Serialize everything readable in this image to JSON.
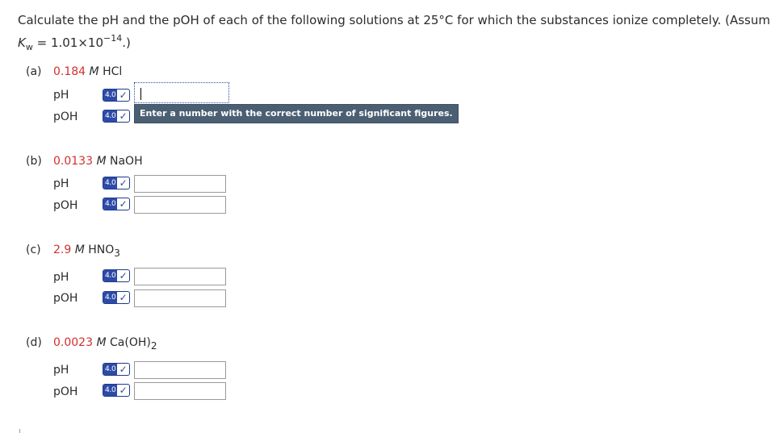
{
  "question": {
    "text": "Calculate the pH and the pOH of each of the following solutions at 25°C for which the substances ionize completely. (Assume",
    "kw_symbol": "K",
    "kw_sub": "w",
    "kw_value": " = 1.01×10",
    "kw_exp": "−14",
    "kw_end": ".)"
  },
  "parts": [
    {
      "letter": "(a)",
      "conc": "0.184",
      "unit": "M",
      "chem": "HCl",
      "chem_sub": "",
      "chem_after": ""
    },
    {
      "letter": "(b)",
      "conc": "0.0133",
      "unit": "M",
      "chem": "NaOH",
      "chem_sub": "",
      "chem_after": ""
    },
    {
      "letter": "(c)",
      "conc": "2.9",
      "unit": "M",
      "chem": "HNO",
      "chem_sub": "3",
      "chem_after": ""
    },
    {
      "letter": "(d)",
      "conc": "0.0023",
      "unit": "M",
      "chem": "Ca(OH)",
      "chem_sub": "2",
      "chem_after": ""
    }
  ],
  "labels": {
    "ph": "pH",
    "poh": "pOH"
  },
  "badge": {
    "version": "4.0",
    "check": "✓"
  },
  "tooltip": "Enter a number with the correct number of significant figures.",
  "inputs": {
    "a_ph": "",
    "a_poh": "",
    "b_ph": "",
    "b_poh": "",
    "c_ph": "",
    "c_poh": "",
    "d_ph": "",
    "d_poh": ""
  },
  "colors": {
    "concentration": "#d32f2f",
    "badge": "#2d4aa7",
    "tooltip_bg": "#4b5f73"
  }
}
